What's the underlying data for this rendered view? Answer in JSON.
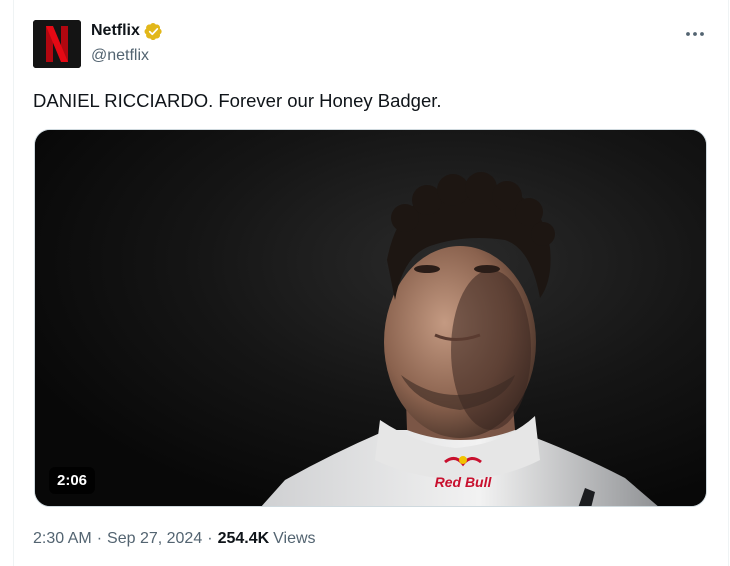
{
  "author": {
    "display_name": "Netflix",
    "handle": "@netflix",
    "avatar_icon": "netflix-n-logo",
    "avatar_letter": "N",
    "verified_icon": "verified-badge-icon",
    "verified_color": "#e2b719"
  },
  "tweet": {
    "text": "DANIEL RICCIARDO. Forever our Honey Badger."
  },
  "media": {
    "type": "video",
    "duration": "2:06",
    "shirt_logo_text": "Red Bull"
  },
  "meta": {
    "time": "2:30 AM",
    "separator": "·",
    "date": "Sep 27, 2024",
    "views_count": "254.4K",
    "views_label": "Views"
  },
  "colors": {
    "text_primary": "#0f1419",
    "text_secondary": "#536471",
    "netflix_red": "#e50914"
  }
}
